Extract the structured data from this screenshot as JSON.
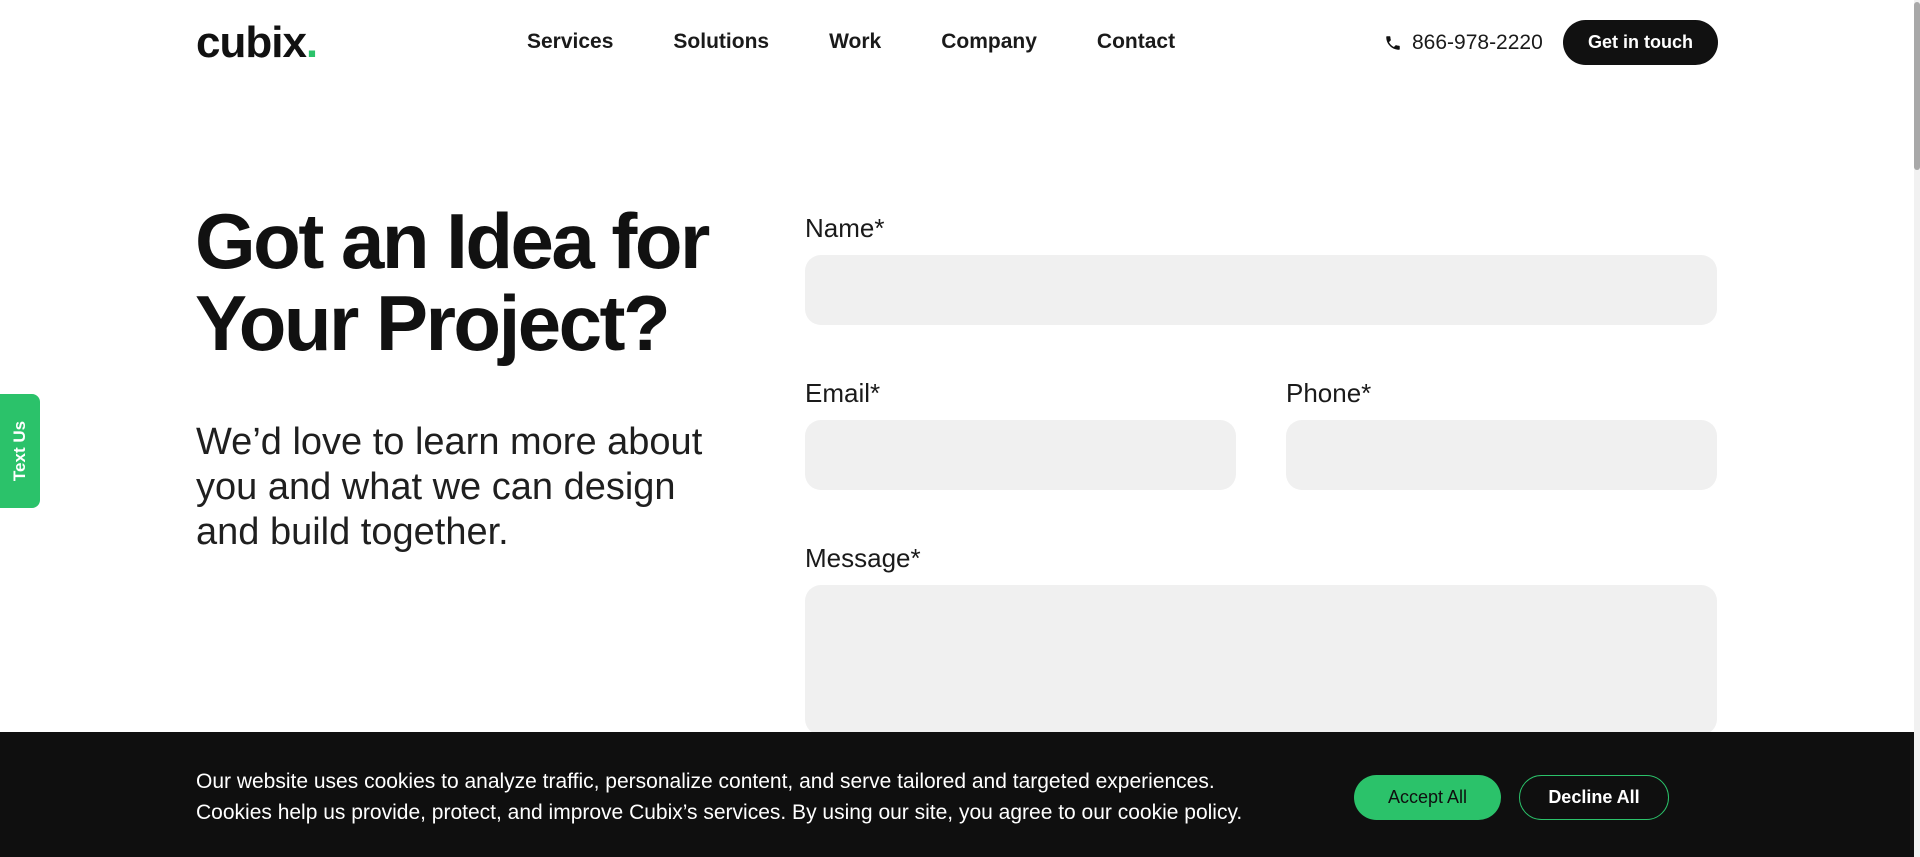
{
  "header": {
    "logo": "cubix",
    "logo_dot": ".",
    "nav": [
      "Services",
      "Solutions",
      "Work",
      "Company",
      "Contact"
    ],
    "phone": "866-978-2220",
    "phone_icon": "phone-icon",
    "cta": "Get in touch"
  },
  "side_tab": {
    "label": "Text Us"
  },
  "hero": {
    "title_line1": "Got an Idea for",
    "title_line2": "Your Project?",
    "subtitle": "We’d love to learn more about you and what we can design and build together."
  },
  "form": {
    "name_label": "Name*",
    "name_value": "",
    "email_label": "Email*",
    "email_value": "",
    "phone_label": "Phone*",
    "phone_value": "",
    "message_label": "Message*",
    "message_value": ""
  },
  "cookie_banner": {
    "line1": "Our website uses cookies to analyze traffic, personalize content, and serve tailored and targeted experiences.",
    "line2": "Cookies help us provide, protect, and improve Cubix’s services. By using our site, you agree to our cookie policy.",
    "accept": "Accept All",
    "decline": "Decline All"
  },
  "colors": {
    "accent": "#2bc26a",
    "dark": "#111111",
    "field_bg": "#f0f0f0",
    "banner_bg": "#0f0f0f"
  }
}
